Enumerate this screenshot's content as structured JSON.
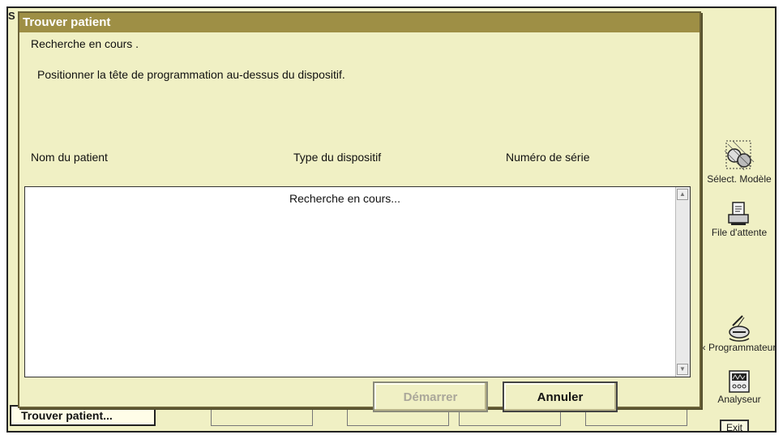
{
  "dialog": {
    "title": "Trouver patient",
    "status": "Recherche en cours    .",
    "instruction": "Positionner la tête de programmation au-dessus du dispositif.",
    "columns": [
      "Nom du patient",
      "Type du dispositif",
      "Numéro de série"
    ],
    "list_message": "Recherche en cours...",
    "start_label": "Démarrer",
    "cancel_label": "Annuler"
  },
  "taskbar": {
    "active_tab": "Trouver patient..."
  },
  "tools": [
    {
      "label": "Sélect. Modèle",
      "icon": "model-select-icon"
    },
    {
      "label": "File d'attente",
      "icon": "printer-icon"
    },
    {
      "label": "‹ Programmateur",
      "icon": "programmer-icon"
    },
    {
      "label": "Analyseur",
      "icon": "analyzer-icon"
    }
  ],
  "exit_label": "Exit"
}
